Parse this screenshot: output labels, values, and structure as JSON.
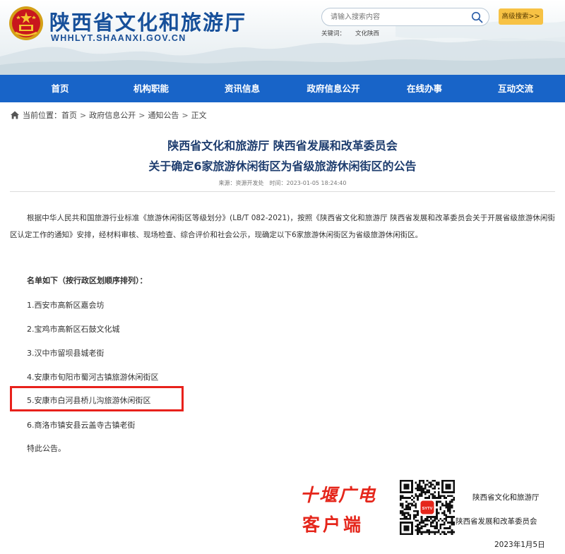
{
  "header": {
    "site_title": "陕西省文化和旅游厅",
    "site_domain": "WHHLYT.SHAANXI.GOV.CN",
    "search_placeholder": "请输入搜索内容",
    "advanced_search_label": "高级搜索>>",
    "keywords_label": "关键词：",
    "keywords_value": "文化陕西"
  },
  "nav": {
    "items": [
      "首页",
      "机构职能",
      "资讯信息",
      "政府信息公开",
      "在线办事",
      "互动交流"
    ]
  },
  "breadcrumb": {
    "label": "当前位置：",
    "items": [
      "首页",
      "政府信息公开",
      "通知公告",
      "正文"
    ],
    "separator": ">"
  },
  "article": {
    "title_line1": "陕西省文化和旅游厅 陕西省发展和改革委员会",
    "title_line2": "关于确定6家旅游休闲街区为省级旅游休闲街区的公告",
    "meta_source": "来源：资源开发处",
    "meta_time": "时间：2023-01-05 18:24:40",
    "body": "根据中华人民共和国旅游行业标准《旅游休闲街区等级划分》(LB/T 082-2021)，按照《陕西省文化和旅游厅 陕西省发展和改革委员会关于开展省级旅游休闲街区认定工作的通知》安排，经材料审核、现场检查、综合评价和社会公示，现确定以下6家旅游休闲街区为省级旅游休闲街区。",
    "list_heading": "名单如下（按行政区划顺序排列）：",
    "list": [
      "1.西安市高新区嘉会坊",
      "2.宝鸡市高新区石鼓文化城",
      "3.汉中市留坝县城老街",
      "4.安康市旬阳市蜀河古镇旅游休闲街区",
      "5.安康市白河县桥儿沟旅游休闲街区",
      "6.商洛市镇安县云盖寺古镇老街"
    ],
    "closing": "特此公告。",
    "signature_1": "陕西省文化和旅游厅",
    "signature_2": "陕西省发展和改革委员会",
    "date": "2023年1月5日"
  },
  "watermark": {
    "line1": "十堰广电",
    "line2": "客户端",
    "qr_badge": "SYTV"
  },
  "colors": {
    "nav_bg": "#1864c8",
    "title_blue": "#17509a",
    "highlight_red": "#e8211b",
    "watermark_red": "#e5261b",
    "button_yellow": "#f7c244"
  }
}
